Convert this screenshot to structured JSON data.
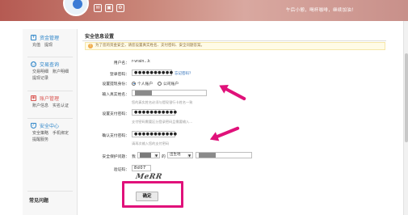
{
  "banner": {
    "tagline": "午后小憩，喝杯咖啡，继续加油！"
  },
  "sidebar": {
    "groups": [
      {
        "title": "资金管理",
        "links": [
          "充值",
          "提现"
        ]
      },
      {
        "title": "交易查询",
        "links": [
          "交易明细",
          "账户明细",
          "提现记录"
        ]
      },
      {
        "title": "账户管理",
        "links": [
          "账户信息",
          "实名认证"
        ]
      },
      {
        "title": "安全中心",
        "links": [
          "安全策略",
          "手机绑定",
          "提醒服务"
        ]
      }
    ],
    "faq_title": "常见问题"
  },
  "main": {
    "title": "安全信息设置",
    "notice": "为了您的资金安全，请您设置真实姓名、支付密码、安全问题答案。",
    "form": {
      "username_label": "用户名：",
      "username_value": "r-vrain...k",
      "login_pw_label": "登录密码：",
      "login_pw_value": "●●●●●●●●●●",
      "forgot_link": "忘记密码？",
      "identity_label": "设置提现身份：",
      "identity_personal": "个人账户",
      "identity_company": "公司账户",
      "realname_label": "输入真实姓名：",
      "realname_hint": "您的真实姓名必须与提现银行卡姓名一致",
      "paypw_label": "设置支付密码：",
      "paypw_value": "●●●●●●●●●●●",
      "paypw_hint": "支付密码需要区分登录密码且需要输入...",
      "confirm_pw_label": "确认支付密码：",
      "confirm_pw_value": "●●●●●●●●●●●",
      "confirm_pw_hint": "请再次输入您的支付密码",
      "question_label": "安全保护问题：",
      "question_prefix": "我",
      "question_select": "的",
      "question_select2": "出生地",
      "captcha_label": "验证码：",
      "captcha_value": "8d07",
      "captcha_image_text": "MeRR",
      "submit_label": "确定"
    }
  },
  "colors": {
    "accent": "#2f86c9",
    "highlight": "#e0117a"
  }
}
